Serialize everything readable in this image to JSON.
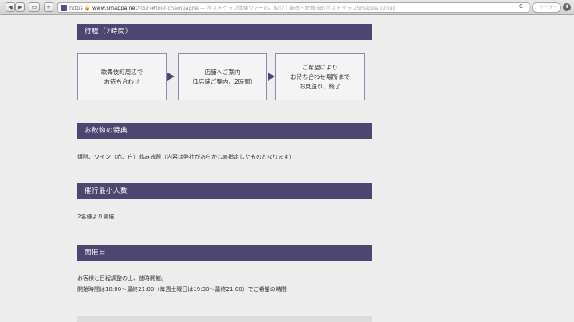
{
  "browser": {
    "back_glyph": "◀",
    "forward_glyph": "▶",
    "sidebar_glyph": "▭",
    "new_tab_glyph": "+",
    "url_scheme": "https",
    "url_host": "www.smappa.net",
    "url_path": "/tour/#tour-champagne",
    "page_title": " — ホストクラブ体験ツアーのご紹介｜新宿・歌舞伎町ホストクラブSmappa!Group",
    "search_placeholder": "リーダー",
    "reload_glyph": "C",
    "download_glyph": "⬇"
  },
  "sections": {
    "itinerary": {
      "heading": "行程（2時間）",
      "steps": [
        "歌舞伎町周辺で\nお待ち合わせ",
        "店舗へご案内\n（1店舗ご案内、2時間）",
        "ご希望により\nお待ち合わせ場所まで\nお見送り、終了"
      ]
    },
    "drinks": {
      "heading": "お飲物の特典",
      "text": "焼酎、ワイン（赤、白）飲み放題（内容は弊社があらかじめ指定したものとなります）"
    },
    "min_people": {
      "heading": "催行最小人数",
      "text": "2名様より開催"
    },
    "dates": {
      "heading": "開催日",
      "line1": "お客様と日程調整の上、随時開催。",
      "line2": "開始時間は18:00〜最終21:00（毎週土曜日は19:30〜最終21:00）でご希望の時間"
    }
  },
  "colors": {
    "band": "#4e4670",
    "step_border": "#8f89b0",
    "background": "#ededed"
  }
}
